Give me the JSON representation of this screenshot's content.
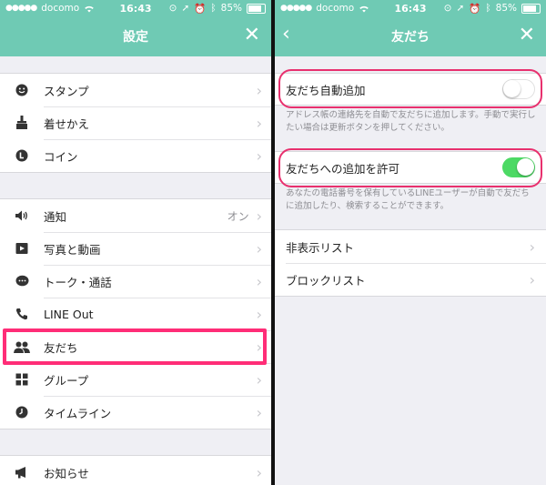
{
  "status_bar": {
    "carrier": "docomo",
    "time": "16:43",
    "battery": "85%"
  },
  "left_panel": {
    "title": "設定",
    "groups": [
      [
        {
          "label": "スタンプ",
          "icon": "smiley-icon"
        },
        {
          "label": "着せかえ",
          "icon": "brush-icon"
        },
        {
          "label": "コイン",
          "icon": "coin-icon"
        }
      ],
      [
        {
          "label": "通知",
          "icon": "speaker-icon",
          "value": "オン"
        },
        {
          "label": "写真と動画",
          "icon": "photo-video-icon"
        },
        {
          "label": "トーク・通話",
          "icon": "chat-bubble-icon"
        },
        {
          "label": "LINE Out",
          "icon": "phone-icon"
        },
        {
          "label": "友だち",
          "icon": "friends-icon"
        },
        {
          "label": "グループ",
          "icon": "group-icon"
        },
        {
          "label": "タイムライン",
          "icon": "clock-icon"
        }
      ],
      [
        {
          "label": "お知らせ",
          "icon": "megaphone-icon"
        }
      ]
    ]
  },
  "right_panel": {
    "title": "友だち",
    "auto_add": {
      "label": "友だち自動追加",
      "enabled": false,
      "note": "アドレス帳の連絡先を自動で友だちに追加します。手動で実行したい場合は更新ボタンを押してください。"
    },
    "allow_add": {
      "label": "友だちへの追加を許可",
      "enabled": true,
      "note": "あなたの電話番号を保有しているLINEユーザーが自動で友だちに追加したり、検索することができます。"
    },
    "lists": [
      {
        "label": "非表示リスト"
      },
      {
        "label": "ブロックリスト"
      }
    ]
  },
  "colors": {
    "header": "#6fcab4",
    "highlight": "#ff2d77",
    "toggle_on": "#4cd964"
  }
}
